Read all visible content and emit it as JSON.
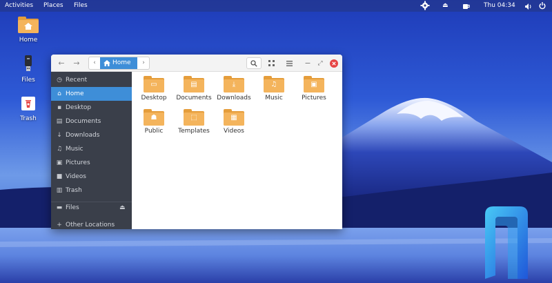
{
  "topbar": {
    "activities": "Activities",
    "places": "Places",
    "files": "Files",
    "clock": "Thu 04:34"
  },
  "desktop": {
    "icons": [
      {
        "label": "Home",
        "icon": "home-folder-icon"
      },
      {
        "label": "Files",
        "icon": "usb-drive-icon"
      },
      {
        "label": "Trash",
        "icon": "trash-icon"
      }
    ]
  },
  "window": {
    "path": "Home",
    "sidebar": {
      "items": [
        {
          "label": "Recent",
          "icon": "clock-icon"
        },
        {
          "label": "Home",
          "icon": "home-icon"
        },
        {
          "label": "Desktop",
          "icon": "desktop-icon"
        },
        {
          "label": "Documents",
          "icon": "document-icon"
        },
        {
          "label": "Downloads",
          "icon": "download-icon"
        },
        {
          "label": "Music",
          "icon": "music-icon"
        },
        {
          "label": "Pictures",
          "icon": "picture-icon"
        },
        {
          "label": "Videos",
          "icon": "video-icon"
        },
        {
          "label": "Trash",
          "icon": "trash-icon"
        }
      ],
      "devices": [
        {
          "label": "Files",
          "icon": "drive-icon"
        },
        {
          "label": "Other Locations",
          "icon": "plus-icon"
        }
      ]
    },
    "folders": [
      {
        "label": "Desktop",
        "icon": "desktop-icon"
      },
      {
        "label": "Documents",
        "icon": "document-icon"
      },
      {
        "label": "Downloads",
        "icon": "download-icon"
      },
      {
        "label": "Music",
        "icon": "music-icon"
      },
      {
        "label": "Pictures",
        "icon": "picture-icon"
      },
      {
        "label": "Public",
        "icon": "people-icon"
      },
      {
        "label": "Templates",
        "icon": "template-icon"
      },
      {
        "label": "Videos",
        "icon": "film-icon"
      }
    ]
  },
  "colors": {
    "accent": "#3e8ed8",
    "sidebar_bg": "#3a3f4a",
    "folder": "#f4b45c",
    "close": "#e64545"
  }
}
